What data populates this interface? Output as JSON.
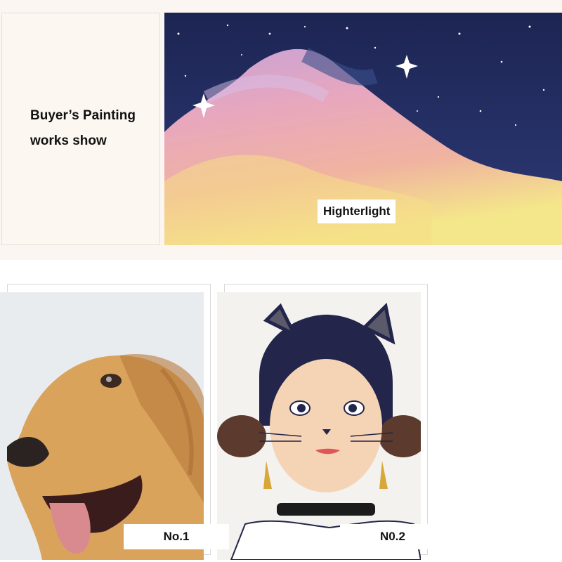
{
  "intro": {
    "line1": "Buyer’s Painting",
    "line2": "works show"
  },
  "highlight": {
    "label": "Highterlight"
  },
  "works": [
    {
      "label": "No.1",
      "subject": "golden retriever colored-pencil portrait"
    },
    {
      "label": "N0.2",
      "subject": "girl with cat ears watercolor illustration"
    }
  ],
  "colors": {
    "background_band": "#fbf6f1",
    "sky_navy": "#243063",
    "nebula_pink": "#e6a6b8",
    "nebula_yellow": "#f2e58a",
    "dog_gold": "#d9a35c"
  }
}
